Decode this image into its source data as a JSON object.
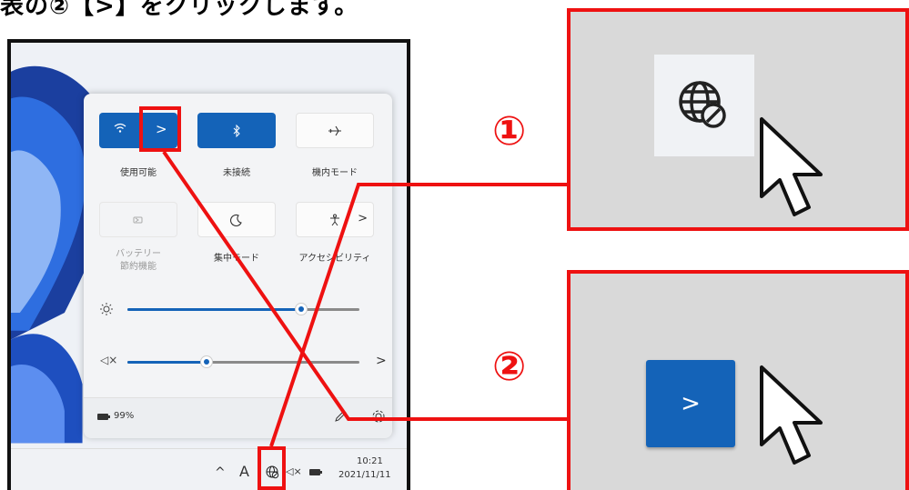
{
  "header": {
    "text": "表の②【>】をクリックします。"
  },
  "quick_settings": {
    "tiles": [
      {
        "label": "使用可能",
        "state": "on",
        "icon": "wifi-icon"
      },
      {
        "label": "未接続",
        "state": "on",
        "icon": "bluetooth-icon"
      },
      {
        "label": "機内モード",
        "state": "off",
        "icon": "airplane-icon"
      },
      {
        "label": "バッテリー\n節約機能",
        "state": "disabled",
        "icon": "battery-saver-icon"
      },
      {
        "label": "集中モード",
        "state": "off",
        "icon": "moon-icon"
      },
      {
        "label": "アクセシビリティ",
        "state": "off",
        "icon": "accessibility-icon"
      }
    ],
    "expand_glyph": ">",
    "brightness_level": 0.75,
    "volume_level": 0.34,
    "battery_text": "99%"
  },
  "taskbar": {
    "ime_text": "A",
    "time": "10:21",
    "date": "2021/11/11"
  },
  "callouts": {
    "one": {
      "number": "①",
      "icon": "globe-blocked-icon"
    },
    "two": {
      "number": "②",
      "button_glyph": ">"
    }
  },
  "colors": {
    "accent": "#1463b8",
    "highlight_red": "#ee1111",
    "zoom_bg": "#d9d9d9"
  }
}
